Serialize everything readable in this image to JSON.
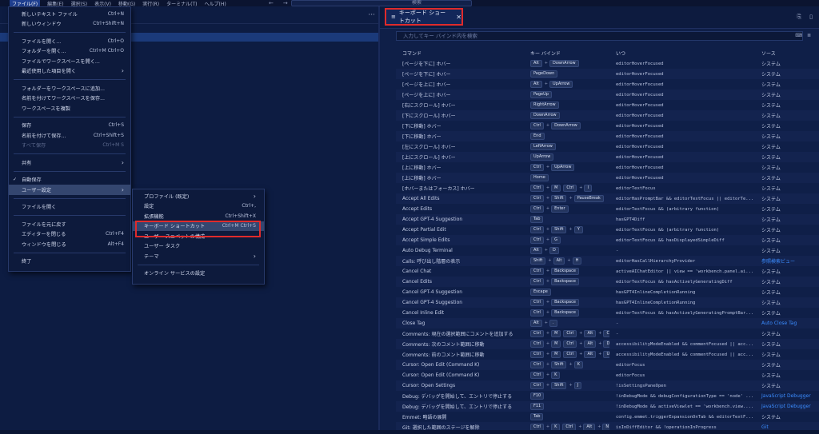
{
  "menubar": {
    "items": [
      "ファイル(F)",
      "編集(E)",
      "選択(S)",
      "表示(V)",
      "移動(G)",
      "実行(R)",
      "ターミナル(T)",
      "ヘルプ(H)"
    ],
    "nav_back": "←",
    "nav_forward": "→",
    "search_placeholder": "検索"
  },
  "file_menu": {
    "groups": [
      [
        {
          "label": "新しいテキスト ファイル",
          "shortcut": "Ctrl+N"
        },
        {
          "label": "新しいウィンドウ",
          "shortcut": "Ctrl+Shift+N"
        }
      ],
      [
        {
          "label": "ファイルを開く...",
          "shortcut": "Ctrl+O"
        },
        {
          "label": "フォルダーを開く...",
          "shortcut": "Ctrl+M Ctrl+O"
        },
        {
          "label": "ファイルでワークスペースを開く...",
          "shortcut": ""
        },
        {
          "label": "最近使用した項目を開く",
          "shortcut": "",
          "submenu": true
        }
      ],
      [
        {
          "label": "フォルダーをワークスペースに追加...",
          "shortcut": ""
        },
        {
          "label": "名前を付けてワークスペースを保存...",
          "shortcut": ""
        },
        {
          "label": "ワークスペースを複製",
          "shortcut": ""
        }
      ],
      [
        {
          "label": "保存",
          "shortcut": "Ctrl+S"
        },
        {
          "label": "名前を付けて保存...",
          "shortcut": "Ctrl+Shift+S"
        },
        {
          "label": "すべて保存",
          "shortcut": "Ctrl+M S",
          "disabled": true
        }
      ],
      [
        {
          "label": "共有",
          "shortcut": "",
          "submenu": true
        }
      ],
      [
        {
          "label": "自動保存",
          "shortcut": "",
          "checked": true
        },
        {
          "label": "ユーザー設定",
          "shortcut": "",
          "submenu": true,
          "hover": true
        }
      ],
      [
        {
          "label": "ファイルを開く",
          "shortcut": ""
        }
      ],
      [
        {
          "label": "ファイルを元に戻す",
          "shortcut": ""
        },
        {
          "label": "エディターを閉じる",
          "shortcut": "Ctrl+F4"
        },
        {
          "label": "ウィンドウを閉じる",
          "shortcut": "Alt+F4"
        }
      ],
      [
        {
          "label": "終了",
          "shortcut": ""
        }
      ]
    ]
  },
  "prefs_menu": {
    "groups": [
      [
        {
          "label": "プロファイル (既定)",
          "shortcut": "",
          "submenu": true
        },
        {
          "label": "設定",
          "shortcut": "Ctrl+,"
        },
        {
          "label": "拡張機能",
          "shortcut": "Ctrl+Shift+X"
        },
        {
          "label": "キーボード ショートカット",
          "shortcut": "Ctrl+M Ctrl+S",
          "hover": true
        },
        {
          "label": "ユーザー スニペットの構成",
          "shortcut": ""
        },
        {
          "label": "ユーザー タスク",
          "shortcut": ""
        },
        {
          "label": "テーマ",
          "shortcut": "",
          "submenu": true
        }
      ],
      [
        {
          "label": "オンライン サービスの設定",
          "shortcut": ""
        }
      ]
    ]
  },
  "editor_tab": {
    "icon": "≡",
    "title": "キーボード ショートカット",
    "close": "✕"
  },
  "keybindings": {
    "search_placeholder": "入力してキー バインド内を検索",
    "columns": [
      "コマンド",
      "キー バインド",
      "いつ",
      "ソース"
    ],
    "rows": [
      {
        "cmd": "[ページを下に] ホバー",
        "keys": [
          [
            "Alt",
            "DownArrow"
          ]
        ],
        "when": "editorHoverFocused",
        "src": "システム"
      },
      {
        "cmd": "[ページを下に] ホバー",
        "keys": [
          [
            "PageDown"
          ]
        ],
        "when": "editorHoverFocused",
        "src": "システム"
      },
      {
        "cmd": "[ページを上に] ホバー",
        "keys": [
          [
            "Alt",
            "UpArrow"
          ]
        ],
        "when": "editorHoverFocused",
        "src": "システム"
      },
      {
        "cmd": "[ページを上に] ホバー",
        "keys": [
          [
            "PageUp"
          ]
        ],
        "when": "editorHoverFocused",
        "src": "システム"
      },
      {
        "cmd": "[右にスクロール] ホバー",
        "keys": [
          [
            "RightArrow"
          ]
        ],
        "when": "editorHoverFocused",
        "src": "システム"
      },
      {
        "cmd": "[下にスクロール] ホバー",
        "keys": [
          [
            "DownArrow"
          ]
        ],
        "when": "editorHoverFocused",
        "src": "システム"
      },
      {
        "cmd": "[下に移動] ホバー",
        "keys": [
          [
            "Ctrl",
            "DownArrow"
          ]
        ],
        "when": "editorHoverFocused",
        "src": "システム"
      },
      {
        "cmd": "[下に移動] ホバー",
        "keys": [
          [
            "End"
          ]
        ],
        "when": "editorHoverFocused",
        "src": "システム"
      },
      {
        "cmd": "[左にスクロール] ホバー",
        "keys": [
          [
            "LeftArrow"
          ]
        ],
        "when": "editorHoverFocused",
        "src": "システム"
      },
      {
        "cmd": "[上にスクロール] ホバー",
        "keys": [
          [
            "UpArrow"
          ]
        ],
        "when": "editorHoverFocused",
        "src": "システム"
      },
      {
        "cmd": "[上に移動] ホバー",
        "keys": [
          [
            "Ctrl",
            "UpArrow"
          ]
        ],
        "when": "editorHoverFocused",
        "src": "システム"
      },
      {
        "cmd": "[上に移動] ホバー",
        "keys": [
          [
            "Home"
          ]
        ],
        "when": "editorHoverFocused",
        "src": "システム"
      },
      {
        "cmd": "[ホバーまたはフォーカス] ホバー",
        "keys": [
          [
            "Ctrl",
            "M"
          ],
          [
            "Ctrl",
            "I"
          ]
        ],
        "when": "editorTextFocus",
        "src": "システム"
      },
      {
        "cmd": "Accept All Edits",
        "keys": [
          [
            "Ctrl",
            "Shift",
            "PauseBreak"
          ]
        ],
        "when": "editorHasPromptBar && editorTextFocus || editorTe...",
        "src": "システム"
      },
      {
        "cmd": "Accept Edits",
        "keys": [
          [
            "Ctrl",
            "Enter"
          ]
        ],
        "when": "editorTextFocus && (arbitrary function)",
        "src": "システム"
      },
      {
        "cmd": "Accept GPT-4 Suggestion",
        "keys": [
          [
            "Tab"
          ]
        ],
        "when": "hasGPT4Diff",
        "src": "システム"
      },
      {
        "cmd": "Accept Partial Edit",
        "keys": [
          [
            "Ctrl",
            "Shift",
            "Y"
          ]
        ],
        "when": "editorTextFocus && (arbitrary function)",
        "src": "システム"
      },
      {
        "cmd": "Accept Simple Edits",
        "keys": [
          [
            "Ctrl",
            "G"
          ]
        ],
        "when": "editorTextFocus && hasDisplayedSimpleDiff",
        "src": "システム"
      },
      {
        "cmd": "Auto Debug Terminal",
        "keys": [
          [
            "Alt",
            "D"
          ]
        ],
        "when": "-",
        "src": "システム"
      },
      {
        "cmd": "Calls: 呼び出し階層の表示",
        "keys": [
          [
            "Shift",
            "Alt",
            "H"
          ]
        ],
        "when": "editorHasCallHierarchyProvider",
        "src": "参照検索ビュー",
        "srclink": true
      },
      {
        "cmd": "Cancel Chat",
        "keys": [
          [
            "Ctrl",
            "Backspace"
          ]
        ],
        "when": "activeAIChatEditor || view == 'workbench.panel.ai...",
        "src": "システム"
      },
      {
        "cmd": "Cancel Edits",
        "keys": [
          [
            "Ctrl",
            "Backspace"
          ]
        ],
        "when": "editorTextFocus && hasActivelyGeneratingDiff",
        "src": "システム"
      },
      {
        "cmd": "Cancel GPT-4 Suggestion",
        "keys": [
          [
            "Escape"
          ]
        ],
        "when": "hasGPT4InlineCompletionRunning",
        "src": "システム"
      },
      {
        "cmd": "Cancel GPT-4 Suggestion",
        "keys": [
          [
            "Ctrl",
            "Backspace"
          ]
        ],
        "when": "hasGPT4InlineCompletionRunning",
        "src": "システム"
      },
      {
        "cmd": "Cancel Inline Edit",
        "keys": [
          [
            "Ctrl",
            "Backspace"
          ]
        ],
        "when": "editorTextFocus && hasActivelyGeneratingPromptBar...",
        "src": "システム"
      },
      {
        "cmd": "Close Tag",
        "keys": [
          [
            "Alt",
            "."
          ]
        ],
        "when": "-",
        "src": "Auto Close Tag",
        "srclink": true
      },
      {
        "cmd": "Comments: 現在の選択範囲にコメントを追加する",
        "keys": [
          [
            "Ctrl",
            "M"
          ],
          [
            "Ctrl",
            "Alt",
            "C"
          ]
        ],
        "when": "-",
        "src": "システム"
      },
      {
        "cmd": "Comments: 次のコメント範囲に移動",
        "keys": [
          [
            "Ctrl",
            "M"
          ],
          [
            "Ctrl",
            "Alt",
            "Down"
          ]
        ],
        "when": "accessibilityModeEnabled && commentFocused || acc...",
        "src": "システム"
      },
      {
        "cmd": "Comments: 前のコメント範囲に移動",
        "keys": [
          [
            "Ctrl",
            "M"
          ],
          [
            "Ctrl",
            "Alt",
            "UpArr"
          ]
        ],
        "when": "accessibilityModeEnabled && commentFocused || acc...",
        "src": "システム"
      },
      {
        "cmd": "Cursor: Open Edit (Command K)",
        "keys": [
          [
            "Ctrl",
            "Shift",
            "K"
          ]
        ],
        "when": "editorFocus",
        "src": "システム"
      },
      {
        "cmd": "Cursor: Open Edit (Command K)",
        "keys": [
          [
            "Ctrl",
            "K"
          ]
        ],
        "when": "editorFocus",
        "src": "システム"
      },
      {
        "cmd": "Cursor: Open Settings",
        "keys": [
          [
            "Ctrl",
            "Shift",
            "J"
          ]
        ],
        "when": "!isSettingsPaneOpen",
        "src": "システム"
      },
      {
        "cmd": "Debug: デバッグを開始して、エントリで停止する",
        "keys": [
          [
            "F10"
          ]
        ],
        "when": "!inDebugMode && debugConfigurationType == 'node' ...",
        "src": "JavaScript Debugger",
        "srclink": true
      },
      {
        "cmd": "Debug: デバッグを開始して、エントリで停止する",
        "keys": [
          [
            "F11"
          ]
        ],
        "when": "!inDebugMode && activeViewlet == 'workbench.view....",
        "src": "JavaScript Debugger",
        "srclink": true
      },
      {
        "cmd": "Emmet: 略語の展開",
        "keys": [
          [
            "Tab"
          ]
        ],
        "when": "config.emmet.triggerExpansionOnTab && editorTextF...",
        "src": "システム"
      },
      {
        "cmd": "Git: 選択した範囲のステージを解除",
        "keys": [
          [
            "Ctrl",
            "K"
          ],
          [
            "Ctrl",
            "Alt",
            "N"
          ]
        ],
        "when": "isInDiffEditor && !operationInProgress",
        "src": "Git",
        "srclink": true
      }
    ]
  }
}
